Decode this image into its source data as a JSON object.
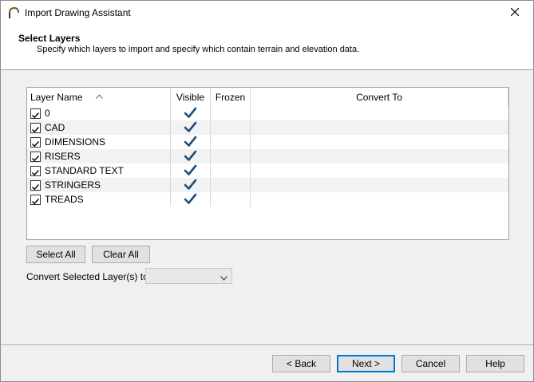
{
  "window": {
    "title": "Import Drawing Assistant"
  },
  "header": {
    "title": "Select Layers",
    "subtitle": "Specify which layers to import and specify which contain terrain and elevation data."
  },
  "grid": {
    "columns": [
      "Layer Name",
      "Visible",
      "Frozen",
      "Convert To"
    ],
    "rows": [
      {
        "name": "0",
        "checked": true,
        "visible": true
      },
      {
        "name": "CAD",
        "checked": true,
        "visible": true
      },
      {
        "name": "DIMENSIONS",
        "checked": true,
        "visible": true
      },
      {
        "name": "RISERS",
        "checked": true,
        "visible": true
      },
      {
        "name": "STANDARD TEXT",
        "checked": true,
        "visible": true
      },
      {
        "name": "STRINGERS",
        "checked": true,
        "visible": true
      },
      {
        "name": "TREADS",
        "checked": true,
        "visible": true
      }
    ]
  },
  "actions": {
    "select_all": "Select All",
    "clear_all": "Clear All",
    "convert_label": "Convert Selected Layer(s) to:",
    "convert_value": ""
  },
  "footer": {
    "back": "< Back",
    "next": "Next >",
    "cancel": "Cancel",
    "help": "Help"
  },
  "colors": {
    "checkmark": "#1f4e79",
    "default_button_border": "#0078d7"
  }
}
